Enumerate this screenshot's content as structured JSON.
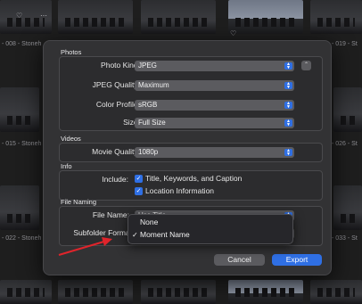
{
  "background": {
    "labels": [
      "- 008 - Stoneh",
      "- 015 - Stoneh",
      "- 022 - Stoneh",
      "- 019 - St",
      "- 026 - St",
      "- 033 - St"
    ]
  },
  "dialog": {
    "photos": {
      "section_title": "Photos",
      "photo_kind": {
        "label": "Photo Kind:",
        "value": "JPEG"
      },
      "jpeg_quality": {
        "label": "JPEG Quality:",
        "value": "Maximum"
      },
      "color_profile": {
        "label": "Color Profile:",
        "value": "sRGB"
      },
      "size": {
        "label": "Size:",
        "value": "Full Size"
      }
    },
    "videos": {
      "section_title": "Videos",
      "movie_quality": {
        "label": "Movie Quality:",
        "value": "1080p"
      }
    },
    "info": {
      "section_title": "Info",
      "include_label": "Include:",
      "checkboxes": [
        {
          "label": "Title, Keywords, and Caption",
          "checked": true
        },
        {
          "label": "Location Information",
          "checked": true
        }
      ]
    },
    "file_naming": {
      "section_title": "File Naming",
      "file_name": {
        "label": "File Name:",
        "value": "Use Title"
      },
      "subfolder_format": {
        "label": "Subfolder Format"
      }
    },
    "subfolder_menu": {
      "options": [
        "None",
        "Moment Name"
      ],
      "selected": "Moment Name"
    },
    "buttons": {
      "cancel": "Cancel",
      "export": "Export"
    }
  },
  "colors": {
    "accent": "#2f6fe4",
    "annotation_arrow": "#e0242b"
  }
}
